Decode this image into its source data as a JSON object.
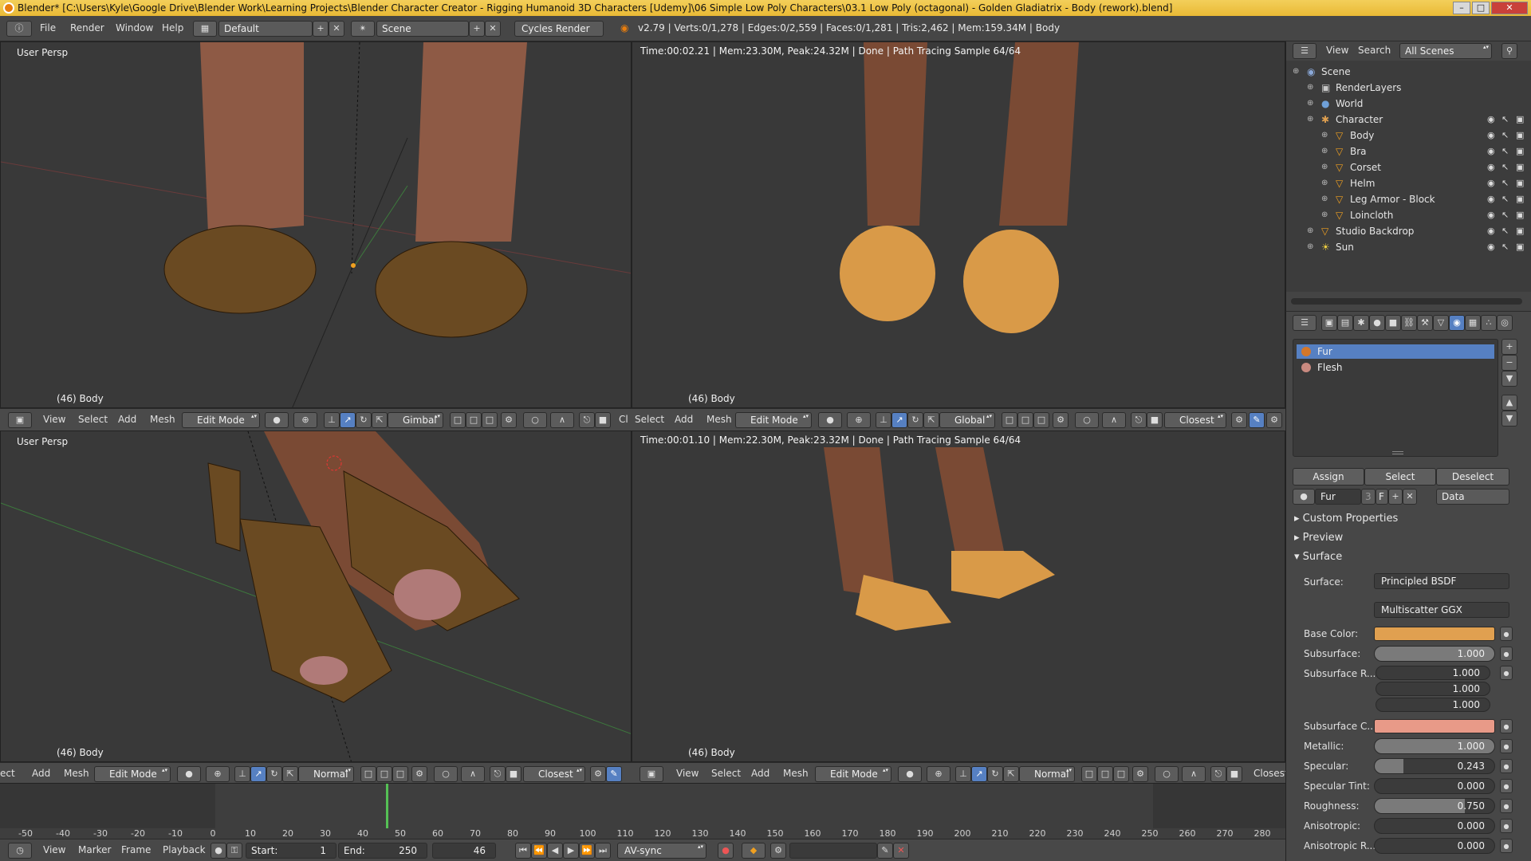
{
  "window": {
    "title": "Blender* [C:\\Users\\Kyle\\Google Drive\\Blender Work\\Learning Projects\\Blender Character Creator - Rigging Humanoid 3D Characters [Udemy]\\06 Simple Low Poly Characters\\03.1 Low Poly (octagonal) - Golden Gladiatrix - Body (rework).blend]"
  },
  "topbar": {
    "menus": [
      "File",
      "Render",
      "Window",
      "Help"
    ],
    "layout": "Default",
    "scene": "Scene",
    "engine": "Cycles Render",
    "stats": "v2.79 | Verts:0/1,278 | Edges:0/2,559 | Faces:0/1,281 | Tris:2,462 | Mem:159.34M | Body"
  },
  "viewports": {
    "top_left": {
      "label": "User Persp",
      "object": "(46) Body"
    },
    "top_right": {
      "render_stats": "Time:00:02.21 | Mem:23.30M, Peak:24.32M | Done | Path Tracing Sample 64/64",
      "object": "(46) Body"
    },
    "bottom_left": {
      "label": "User Persp",
      "object": "(46) Body"
    },
    "bottom_right": {
      "render_stats": "Time:00:01.10 | Mem:22.30M, Peak:23.32M | Done | Path Tracing Sample 64/64",
      "object": "(46) Body"
    }
  },
  "viewport_headers": {
    "top_left": {
      "menus": [
        "View",
        "Select",
        "Add",
        "Mesh"
      ],
      "mode": "Edit Mode",
      "orientation": "Gimbal",
      "snap": "Cl"
    },
    "top_right": {
      "menus": [
        "Select",
        "Add",
        "Mesh"
      ],
      "mode": "Edit Mode",
      "orientation": "Global",
      "snap": "Closest"
    },
    "bottom_left": {
      "menus": [
        "ect",
        "Add",
        "Mesh"
      ],
      "mode": "Edit Mode",
      "orientation": "Normal",
      "snap": "Closest"
    },
    "bottom_right": {
      "menus": [
        "View",
        "Select",
        "Add",
        "Mesh"
      ],
      "mode": "Edit Mode",
      "orientation": "Normal",
      "snap": "Closest"
    }
  },
  "outliner": {
    "menus": [
      "View",
      "Search"
    ],
    "filter": "All Scenes",
    "items": [
      {
        "label": "Scene",
        "depth": 0,
        "icon": "scene"
      },
      {
        "label": "RenderLayers",
        "depth": 1,
        "icon": "renderlayers"
      },
      {
        "label": "World",
        "depth": 1,
        "icon": "world"
      },
      {
        "label": "Character",
        "depth": 1,
        "icon": "armature"
      },
      {
        "label": "Body",
        "depth": 2,
        "icon": "mesh"
      },
      {
        "label": "Bra",
        "depth": 2,
        "icon": "mesh"
      },
      {
        "label": "Corset",
        "depth": 2,
        "icon": "mesh"
      },
      {
        "label": "Helm",
        "depth": 2,
        "icon": "mesh"
      },
      {
        "label": "Leg Armor - Block",
        "depth": 2,
        "icon": "mesh"
      },
      {
        "label": "Loincloth",
        "depth": 2,
        "icon": "mesh"
      },
      {
        "label": "Studio Backdrop",
        "depth": 1,
        "icon": "mesh"
      },
      {
        "label": "Sun",
        "depth": 1,
        "icon": "lamp"
      }
    ]
  },
  "material": {
    "slots": [
      {
        "name": "Fur",
        "color": "#d4772a",
        "selected": true
      },
      {
        "name": "Flesh",
        "color": "#c98a80",
        "selected": false
      }
    ],
    "buttons": {
      "assign": "Assign",
      "select": "Select",
      "deselect": "Deselect"
    },
    "name": "Fur",
    "users": "3",
    "fake": "F",
    "link": "Data",
    "sections": {
      "custom_props": "Custom Properties",
      "preview": "Preview",
      "surface": "Surface"
    },
    "surface_label": "Surface:",
    "surface_shader": "Principled BSDF",
    "distribution": "Multiscatter GGX",
    "params": [
      {
        "label": "Base Color:",
        "type": "color",
        "color": "#e0a050"
      },
      {
        "label": "Subsurface:",
        "value": "1.000",
        "fill": 1.0
      },
      {
        "label": "Subsurface R...",
        "type": "vector",
        "values": [
          "1.000",
          "1.000",
          "1.000"
        ]
      },
      {
        "label": "Subsurface C...",
        "type": "color",
        "color": "#e89a88"
      },
      {
        "label": "Metallic:",
        "value": "1.000",
        "fill": 1.0
      },
      {
        "label": "Specular:",
        "value": "0.243",
        "fill": 0.243
      },
      {
        "label": "Specular Tint:",
        "value": "0.000",
        "fill": 0.0
      },
      {
        "label": "Roughness:",
        "value": "0.750",
        "fill": 0.75
      },
      {
        "label": "Anisotropic:",
        "value": "0.000",
        "fill": 0.0
      },
      {
        "label": "Anisotropic R...",
        "value": "0.000",
        "fill": 0.0
      }
    ]
  },
  "timeline": {
    "ticks": [
      "-50",
      "-40",
      "-30",
      "-20",
      "-10",
      "0",
      "10",
      "20",
      "30",
      "40",
      "50",
      "60",
      "70",
      "80",
      "90",
      "100",
      "110",
      "120",
      "130",
      "140",
      "150",
      "160",
      "170",
      "180",
      "190",
      "200",
      "210",
      "220",
      "230",
      "240",
      "250",
      "260",
      "270",
      "280"
    ],
    "menus": [
      "View",
      "Marker",
      "Frame",
      "Playback"
    ],
    "start_label": "Start:",
    "start": "1",
    "end_label": "End:",
    "end": "250",
    "current": "46",
    "sync": "AV-sync"
  }
}
